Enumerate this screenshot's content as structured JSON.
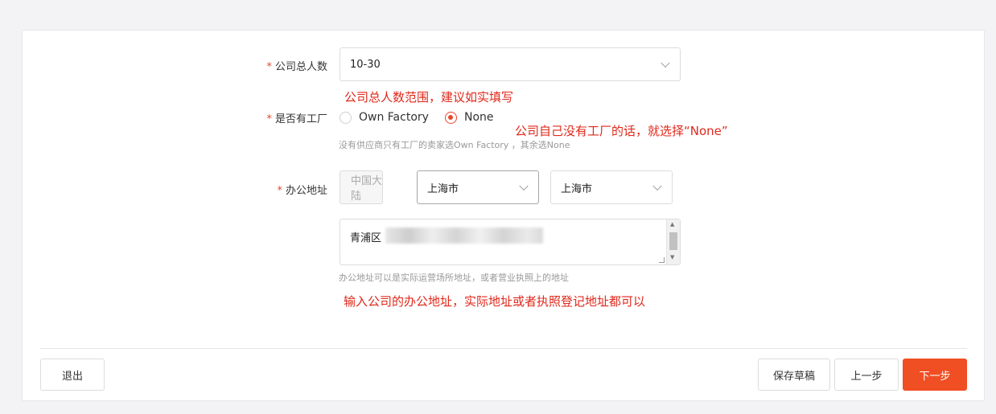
{
  "form": {
    "employees": {
      "required_mark": "*",
      "label": "公司总人数",
      "value": "10-30",
      "annotation": "公司总人数范围，建议如实填写"
    },
    "factory": {
      "required_mark": "*",
      "label": "是否有工厂",
      "options": [
        "Own Factory",
        "None"
      ],
      "selected": "None",
      "annotation": "公司自己没有工厂的话，就选择“None”",
      "hint": "没有供应商只有工厂的卖家选Own Factory ，其余选None"
    },
    "address": {
      "required_mark": "*",
      "label": "办公地址",
      "country": "中国大陆",
      "province": "上海市",
      "city": "上海市",
      "detail": "青浦区",
      "hint": "办公地址可以是实际运营场所地址，或者营业执照上的地址",
      "annotation": "输入公司的办公地址，实际地址或者执照登记地址都可以"
    }
  },
  "footer": {
    "exit_label": "退出",
    "save_draft_label": "保存草稿",
    "prev_label": "上一步",
    "next_label": "下一步"
  },
  "colors": {
    "accent": "#f04e23",
    "annotation": "#e0281b"
  }
}
